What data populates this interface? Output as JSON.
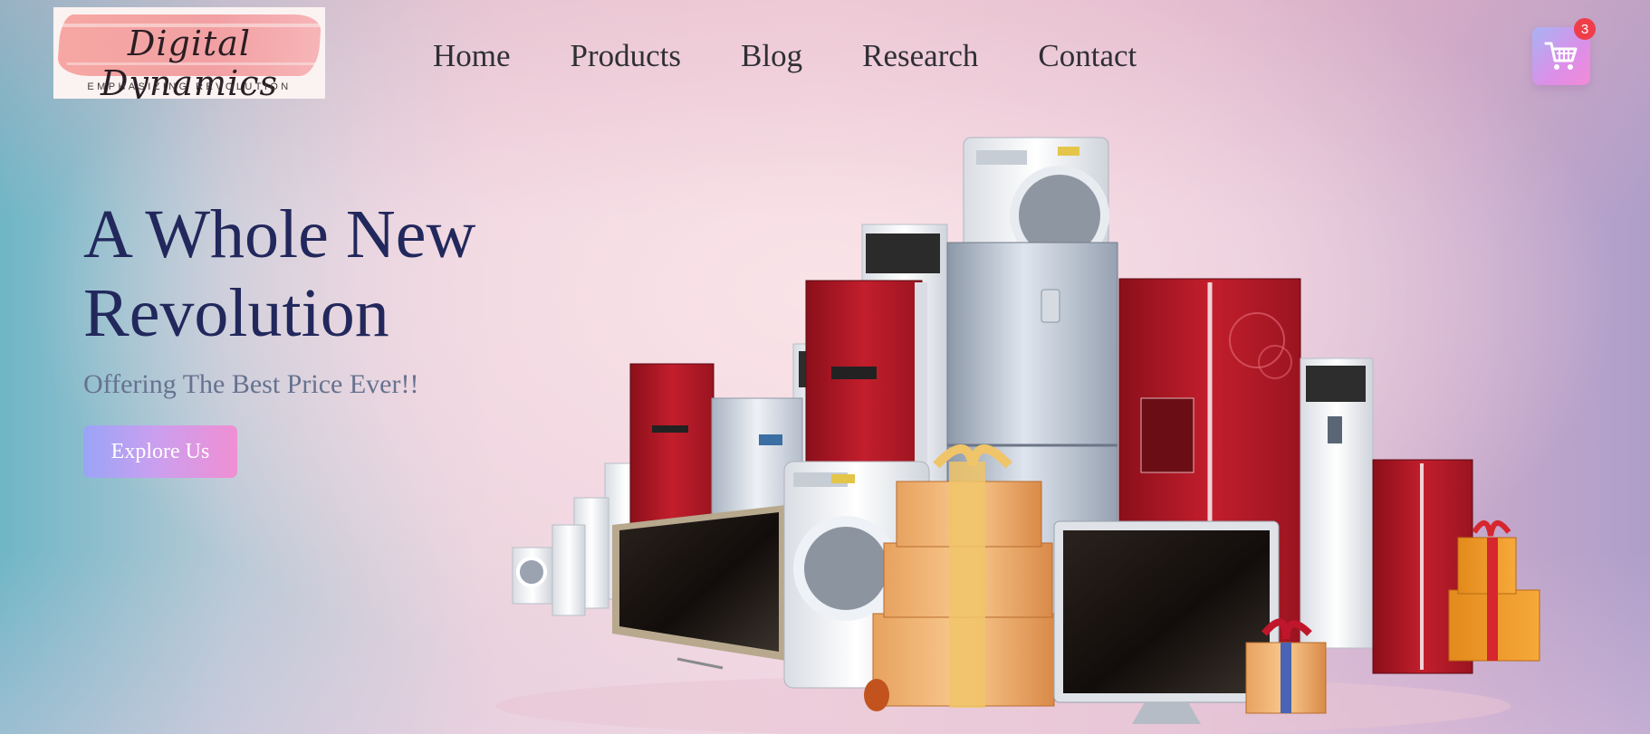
{
  "logo": {
    "script_text": "Digital Dynamics",
    "tagline": "EMPHASIZING REVOLUTION"
  },
  "nav": {
    "items": [
      "Home",
      "Products",
      "Blog",
      "Research",
      "Contact"
    ]
  },
  "cart": {
    "icon": "cart-icon",
    "count": "3"
  },
  "hero": {
    "title_line1": "A Whole New",
    "title_line2": "Revolution",
    "subtitle": "Offering The Best Price Ever!!",
    "cta_label": "Explore Us"
  },
  "colors": {
    "title": "#22285c",
    "subtitle": "#66728f",
    "nav_text": "#2f2f35",
    "badge": "#ef3e4a",
    "button_gradient_start": "#9aa4f6",
    "button_gradient_end": "#f08fd3"
  }
}
